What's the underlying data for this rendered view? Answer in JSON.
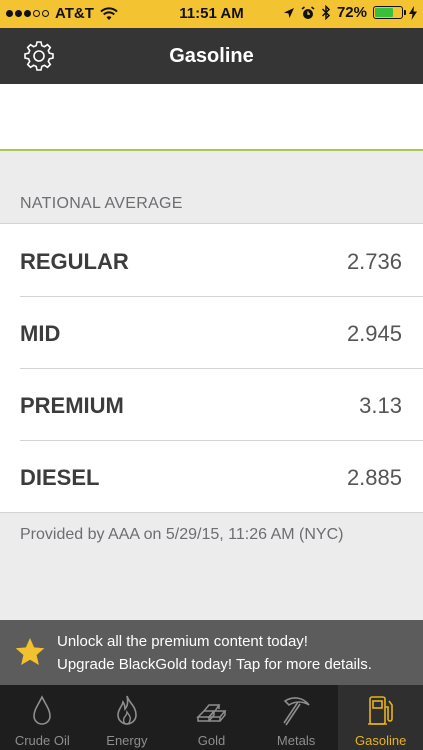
{
  "status_bar": {
    "carrier": "AT&T",
    "time": "11:51 AM",
    "battery": "72%",
    "battery_level": 0.72,
    "signal_bars": 3,
    "signal_total": 5
  },
  "navbar": {
    "title": "Gasoline",
    "settings_icon": "gear-icon"
  },
  "section": {
    "header": "NATIONAL AVERAGE"
  },
  "prices": [
    {
      "label": "REGULAR",
      "value": "2.736"
    },
    {
      "label": "MID",
      "value": "2.945"
    },
    {
      "label": "PREMIUM",
      "value": "3.13"
    },
    {
      "label": "DIESEL",
      "value": "2.885"
    }
  ],
  "footer_note": "Provided by AAA on 5/29/15, 11:26 AM (NYC)",
  "promo": {
    "line1": "Unlock all the premium content today!",
    "line2": "Upgrade BlackGold today! Tap for more details.",
    "icon": "star-icon"
  },
  "tabs": [
    {
      "label": "Crude Oil",
      "icon": "drop-icon",
      "active": false
    },
    {
      "label": "Energy",
      "icon": "flame-icon",
      "active": false
    },
    {
      "label": "Gold",
      "icon": "gold-bars-icon",
      "active": false
    },
    {
      "label": "Metals",
      "icon": "pickaxe-icon",
      "active": false
    },
    {
      "label": "Gasoline",
      "icon": "gas-pump-icon",
      "active": true
    }
  ],
  "colors": {
    "status_bar": "#f4c331",
    "navbar": "#353535",
    "accent_line": "#a9c94d",
    "active_tab": "#e7b21b"
  }
}
